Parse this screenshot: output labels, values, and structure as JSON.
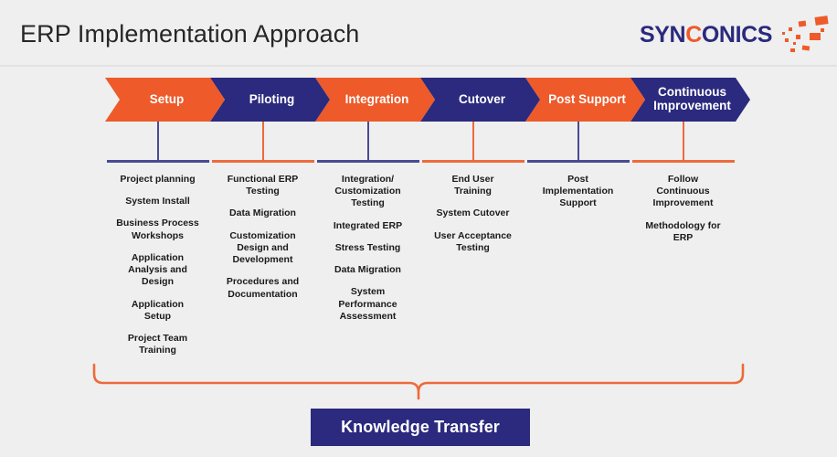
{
  "header": {
    "title": "ERP Implementation Approach",
    "logo": {
      "part1": "SYN",
      "accent": "C",
      "part2": "ONICS",
      "icon": "scatter-burst-icon"
    }
  },
  "colors": {
    "orange": "#EE5A2A",
    "navy": "#2B2A7E",
    "background": "#EFEFEF",
    "connector_navy": "#4A4A94",
    "connector_orange": "#EE6A3C",
    "text": "#1A1A1A"
  },
  "phases": [
    {
      "label": "Setup",
      "style": "orange",
      "connector": "navy",
      "items": [
        "Project planning",
        "System Install",
        "Business Process\nWorkshops",
        "Application\nAnalysis and\nDesign",
        "Application\nSetup",
        "Project Team\nTraining"
      ]
    },
    {
      "label": "Piloting",
      "style": "navy",
      "connector": "orange",
      "items": [
        "Functional ERP\nTesting",
        "Data Migration",
        "Customization\nDesign and\nDevelopment",
        "Procedures and\nDocumentation"
      ]
    },
    {
      "label": "Integration",
      "style": "orange",
      "connector": "navy",
      "items": [
        "Integration/\nCustomization\nTesting",
        "Integrated ERP",
        "Stress Testing",
        "Data Migration",
        "System\nPerformance\nAssessment"
      ]
    },
    {
      "label": "Cutover",
      "style": "navy",
      "connector": "orange",
      "items": [
        "End User\nTraining",
        "System Cutover",
        "User Acceptance\nTesting"
      ]
    },
    {
      "label": "Post Support",
      "style": "orange",
      "connector": "navy",
      "items": [
        "Post\nImplementation\nSupport"
      ]
    },
    {
      "label": "Continuous\nImprovement",
      "style": "navy",
      "connector": "orange",
      "items": [
        "Follow\nContinuous\nImprovement",
        "Methodology for\nERP"
      ]
    }
  ],
  "footer": {
    "brace": "curly-brace-icon",
    "knowledge_transfer": "Knowledge Transfer"
  }
}
